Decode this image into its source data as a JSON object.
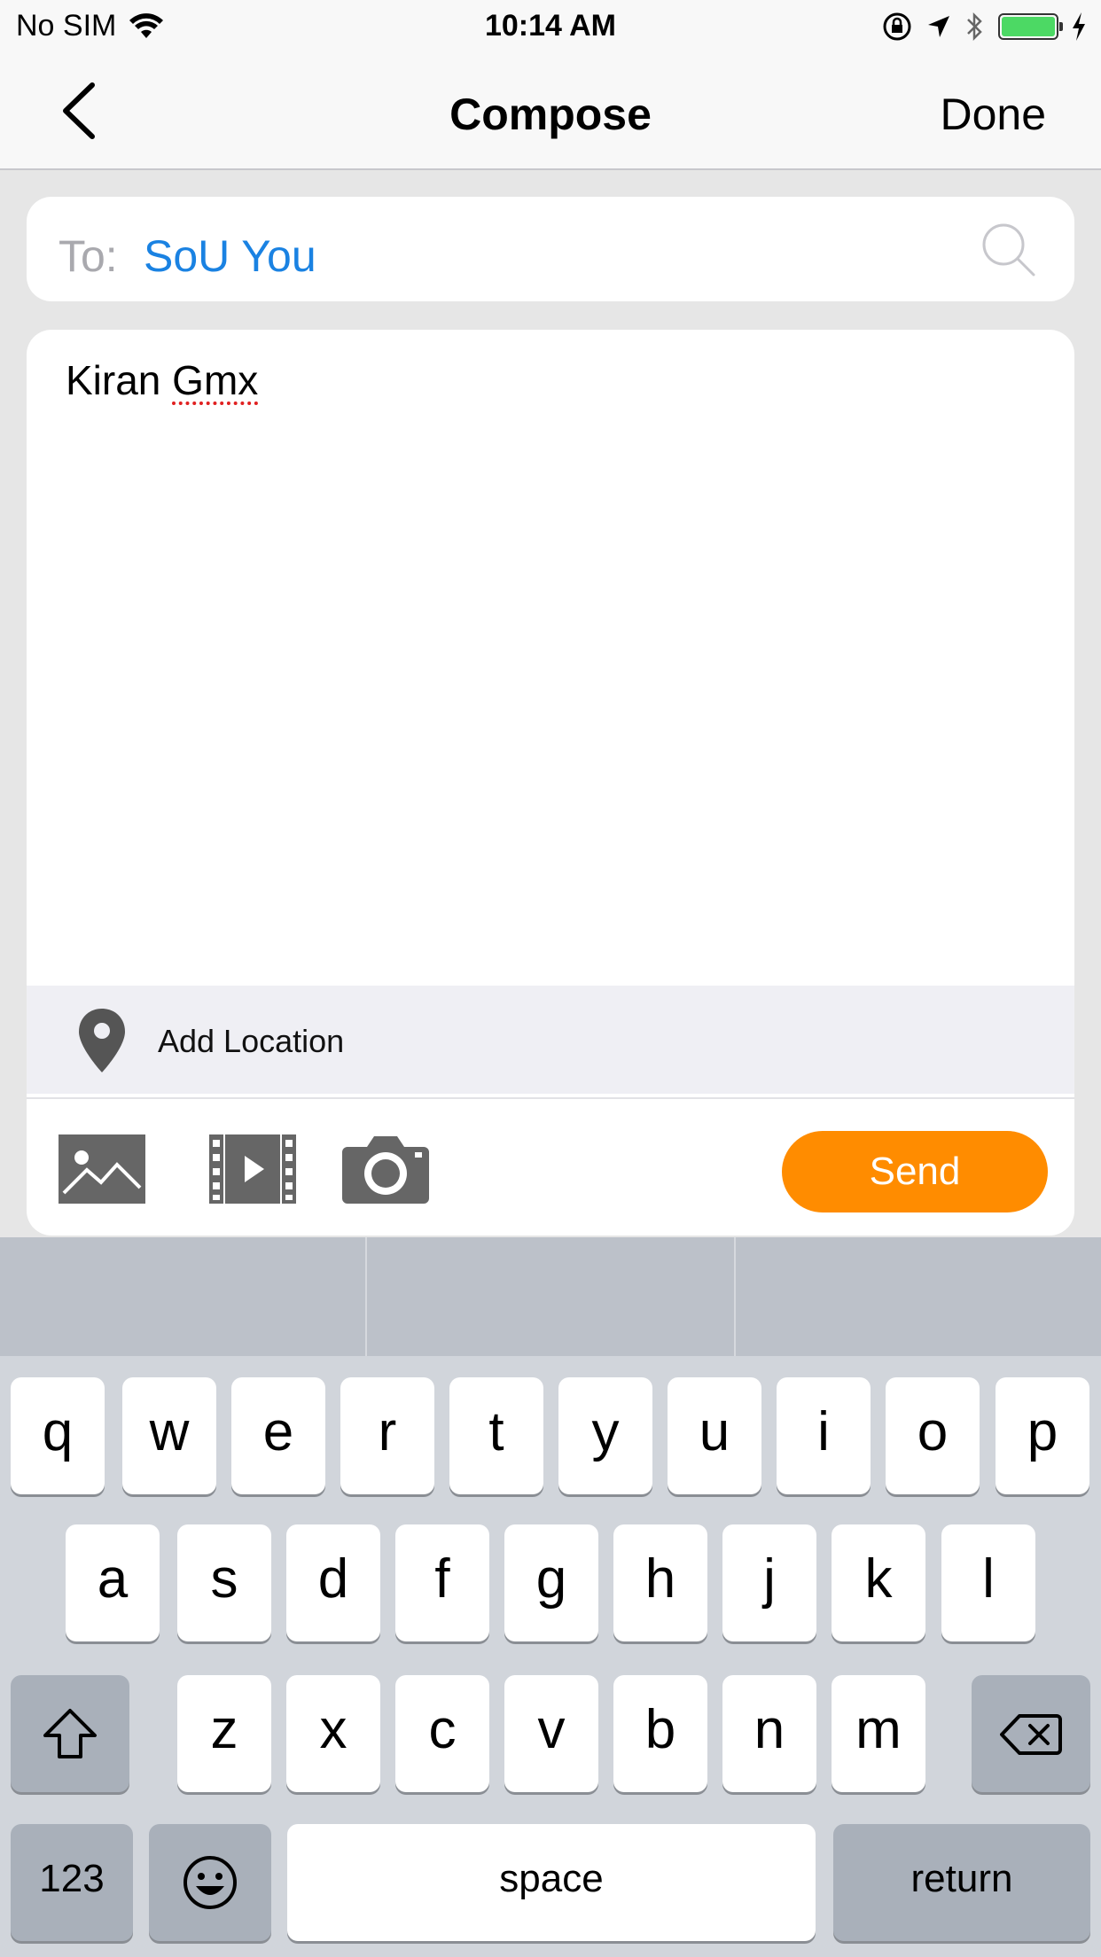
{
  "status_bar": {
    "carrier": "No SIM",
    "time": "10:14 AM",
    "battery_color": "#4cd964"
  },
  "nav": {
    "back_icon": "chevron-left-icon",
    "title": "Compose",
    "done_label": "Done"
  },
  "to_field": {
    "label": "To:",
    "recipient": "SoU You",
    "search_icon": "search-icon",
    "recipient_color": "#1a82e2"
  },
  "compose": {
    "text_plain": "Kiran ",
    "text_misspelled": "Gmx"
  },
  "location": {
    "icon": "map-pin-icon",
    "label": "Add Location"
  },
  "toolbar": {
    "photo_icon": "photo-icon",
    "video_icon": "video-icon",
    "camera_icon": "camera-icon",
    "send_label": "Send",
    "send_color": "#ff8c00"
  },
  "keyboard": {
    "row1": [
      "q",
      "w",
      "e",
      "r",
      "t",
      "y",
      "u",
      "i",
      "o",
      "p"
    ],
    "row2": [
      "a",
      "s",
      "d",
      "f",
      "g",
      "h",
      "j",
      "k",
      "l"
    ],
    "row3": [
      "z",
      "x",
      "c",
      "v",
      "b",
      "n",
      "m"
    ],
    "shift_icon": "shift-icon",
    "delete_icon": "backspace-icon",
    "numbers_label": "123",
    "emoji_icon": "emoji-icon",
    "space_label": "space",
    "return_label": "return"
  }
}
